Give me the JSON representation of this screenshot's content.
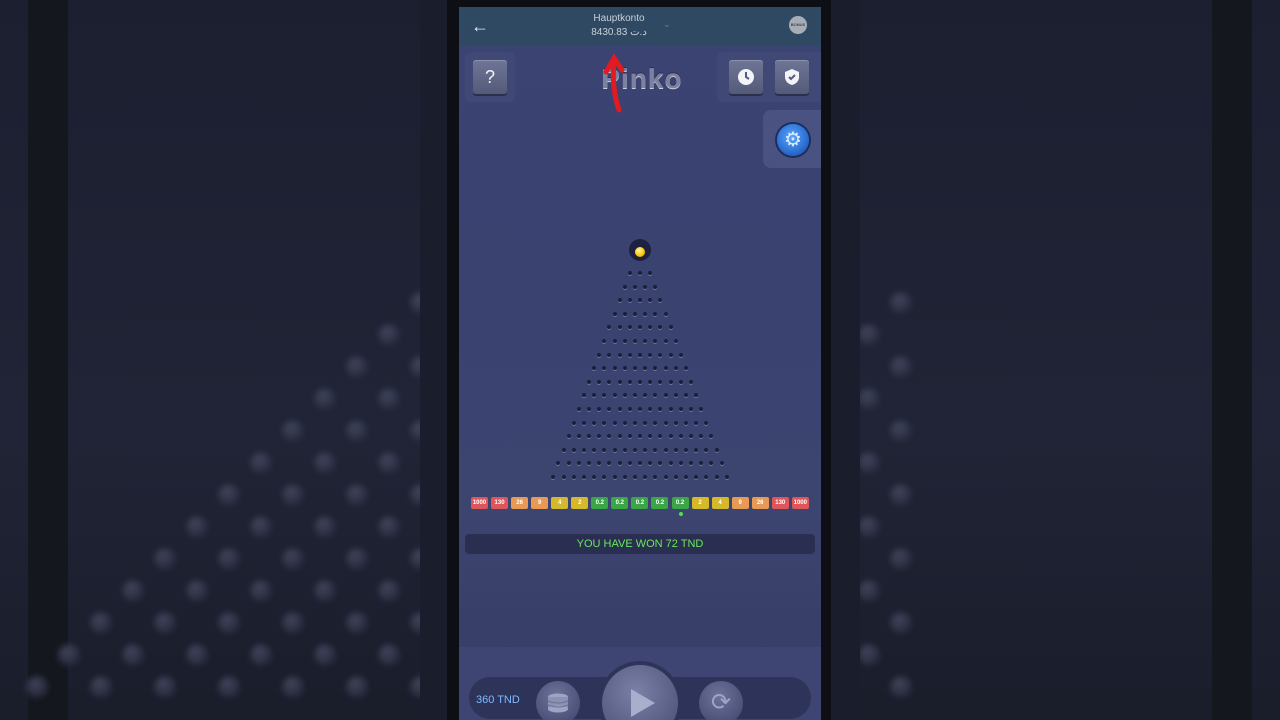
{
  "header": {
    "account_name": "Hauptkonto",
    "balance": "8430.83 د.ت",
    "back_icon": "arrow-left-icon",
    "bonus_label": "BONUS"
  },
  "toolbar": {
    "help_label": "?",
    "history_icon": "clock-icon",
    "fairness_icon": "shield-check-icon",
    "settings_icon": "gear-icon"
  },
  "game": {
    "logo_text": "Pinko",
    "slots": [
      {
        "label": "1000",
        "color": "#e0555a"
      },
      {
        "label": "130",
        "color": "#e0555a"
      },
      {
        "label": "26",
        "color": "#e89a55"
      },
      {
        "label": "9",
        "color": "#e89a55"
      },
      {
        "label": "4",
        "color": "#d6b92b"
      },
      {
        "label": "2",
        "color": "#d6b92b"
      },
      {
        "label": "0.2",
        "color": "#3ba646"
      },
      {
        "label": "0.2",
        "color": "#3ba646"
      },
      {
        "label": "0.2",
        "color": "#3ba646"
      },
      {
        "label": "0.2",
        "color": "#3ba646"
      },
      {
        "label": "0.2",
        "color": "#3ba646"
      },
      {
        "label": "2",
        "color": "#d6b92b"
      },
      {
        "label": "4",
        "color": "#d6b92b"
      },
      {
        "label": "9",
        "color": "#e89a55"
      },
      {
        "label": "26",
        "color": "#e89a55"
      },
      {
        "label": "130",
        "color": "#e0555a"
      },
      {
        "label": "1000",
        "color": "#e0555a"
      }
    ],
    "result_message": "YOU HAVE WON 72 TND"
  },
  "controls": {
    "bet_amount": "360 TND",
    "chips_icon": "coins-stack-icon",
    "play_icon": "play-icon",
    "auto_icon": "refresh-icon"
  }
}
